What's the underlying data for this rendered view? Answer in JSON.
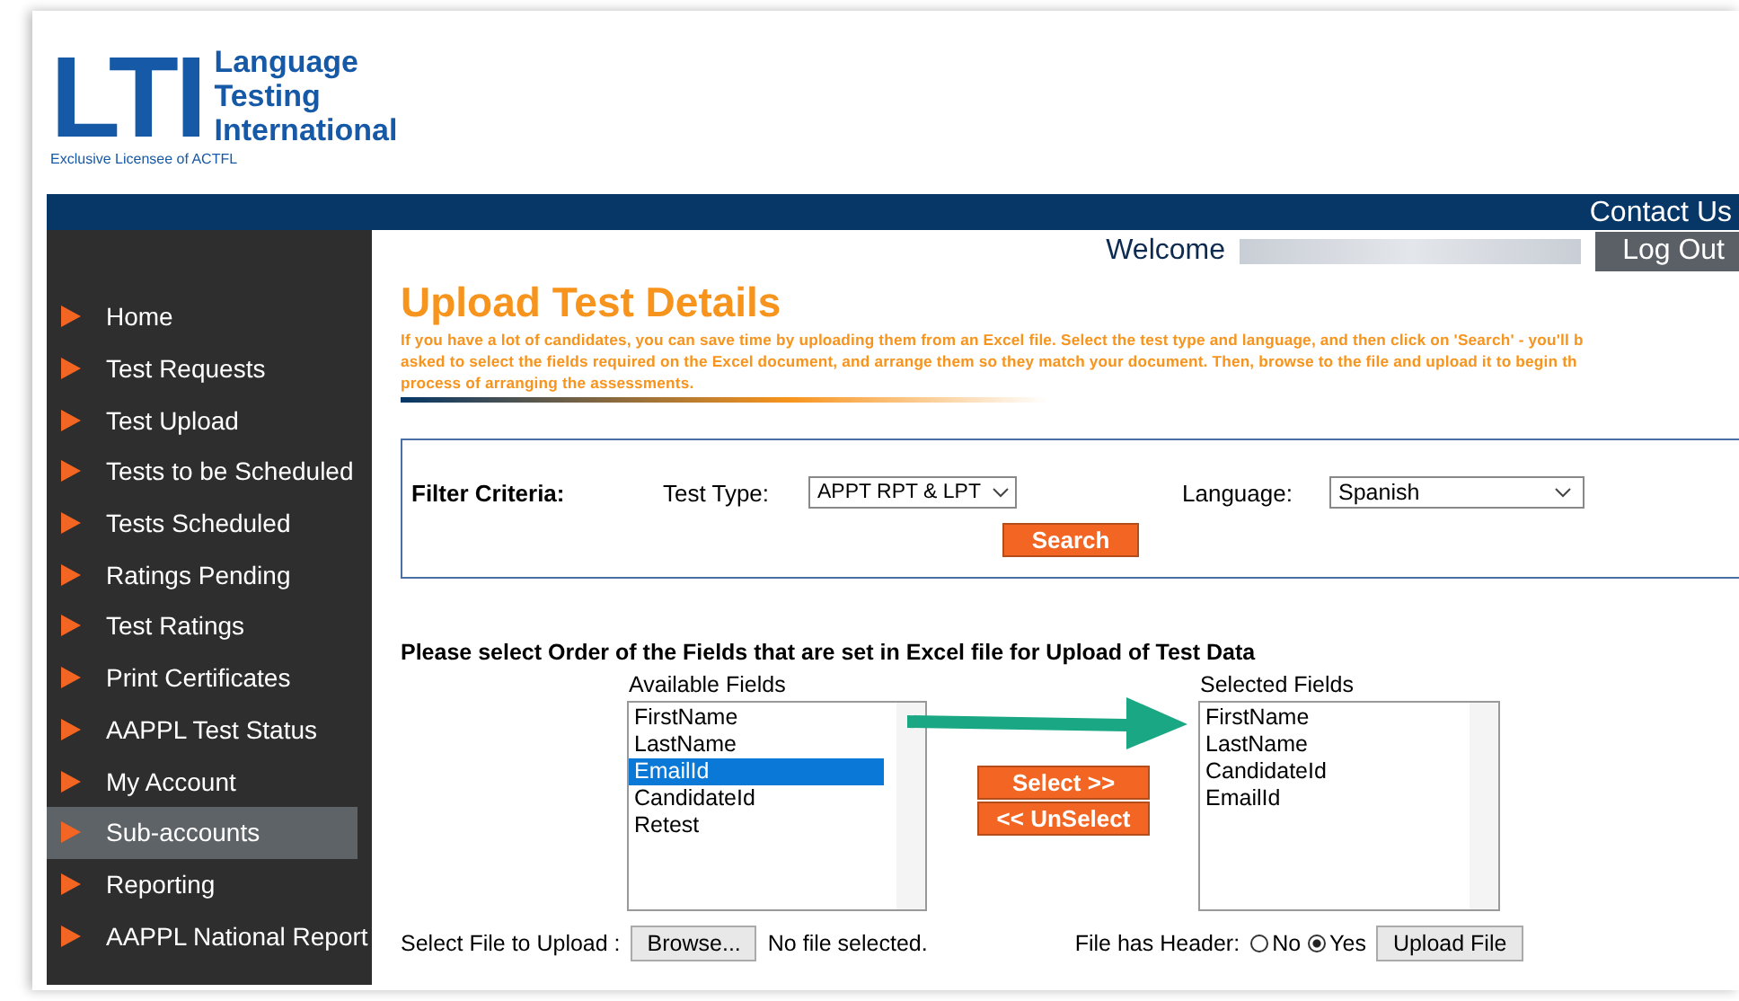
{
  "logo": {
    "letters": "LTI",
    "name_lines": [
      "Language",
      "Testing",
      "International"
    ],
    "tagline": "Exclusive Licensee of ACTFL"
  },
  "top_bar": {
    "contact": "Contact Us"
  },
  "user_bar": {
    "welcome": "Welcome",
    "logout": "Log Out"
  },
  "sidebar": {
    "items": [
      {
        "label": "Home",
        "selected": false
      },
      {
        "label": "Test Requests",
        "selected": false
      },
      {
        "label": "Test Upload",
        "selected": false
      },
      {
        "label": "Tests to be Scheduled",
        "selected": false
      },
      {
        "label": "Tests Scheduled",
        "selected": false
      },
      {
        "label": "Ratings Pending",
        "selected": false
      },
      {
        "label": "Test Ratings",
        "selected": false
      },
      {
        "label": "Print Certificates",
        "selected": false
      },
      {
        "label": "AAPPL Test Status",
        "selected": false
      },
      {
        "label": "My Account",
        "selected": false
      },
      {
        "label": "Sub-accounts",
        "selected": true
      },
      {
        "label": "Reporting",
        "selected": false
      },
      {
        "label": "AAPPL National Report",
        "selected": false
      }
    ]
  },
  "page": {
    "title": "Upload Test Details",
    "description_lines": [
      "If you have a lot of candidates, you can save time by uploading them from an Excel file.  Select the test type and language, and then click on 'Search' - you'll b",
      "asked to select the fields required on the Excel document, and arrange them so they match your document. Then, browse to the file and upload it to begin th",
      "process of arranging the assessments."
    ]
  },
  "filter": {
    "heading": "Filter Criteria:",
    "test_type_label": "Test Type:",
    "test_type_value": "APPT RPT & LPT",
    "language_label": "Language:",
    "language_value": "Spanish",
    "search_button": "Search"
  },
  "fields": {
    "instruction": "Please select Order of the Fields that are set in Excel file for Upload of Test Data",
    "available_label": "Available Fields",
    "available": [
      {
        "label": "FirstName",
        "selected": false
      },
      {
        "label": "LastName",
        "selected": false
      },
      {
        "label": "EmailId",
        "selected": true
      },
      {
        "label": "CandidateId",
        "selected": false
      },
      {
        "label": "Retest",
        "selected": false
      }
    ],
    "select_button": "Select >>",
    "unselect_button": "<< UnSelect",
    "selected_label": "Selected Fields",
    "selected": [
      {
        "label": "FirstName",
        "selected": false
      },
      {
        "label": "LastName",
        "selected": false
      },
      {
        "label": "CandidateId",
        "selected": false
      },
      {
        "label": "EmailId",
        "selected": false
      }
    ]
  },
  "upload": {
    "file_label": "Select File to Upload :",
    "browse_button": "Browse...",
    "file_status": "No file selected.",
    "header_label": "File has Header:",
    "header_options": [
      {
        "label": "No",
        "selected": false
      },
      {
        "label": "Yes",
        "selected": true
      }
    ],
    "upload_button": "Upload File"
  }
}
